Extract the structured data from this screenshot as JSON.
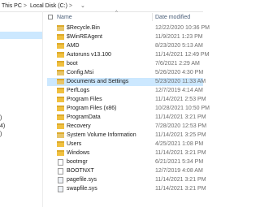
{
  "breadcrumb": {
    "items": [
      "This PC",
      "Local Disk (C:)"
    ],
    "separator": ">"
  },
  "nav_pane": {
    "visible_fragments": [
      ")",
      "4)",
      ")"
    ]
  },
  "columns": {
    "name": "Name",
    "date_modified": "Date modified"
  },
  "files": [
    {
      "name": "$Recycle.Bin",
      "date": "12/22/2020 10:36 PM",
      "type": "folder-system"
    },
    {
      "name": "$WinREAgent",
      "date": "11/9/2021 1:23 PM",
      "type": "folder"
    },
    {
      "name": "AMD",
      "date": "8/23/2020 5:13 AM",
      "type": "folder"
    },
    {
      "name": "Autoruns v13.100",
      "date": "11/14/2021 12:49 PM",
      "type": "folder"
    },
    {
      "name": "boot",
      "date": "7/6/2021 2:29 AM",
      "type": "folder"
    },
    {
      "name": "Config.Msi",
      "date": "5/26/2020 4:30 PM",
      "type": "folder-system"
    },
    {
      "name": "Documents and Settings",
      "date": "5/23/2020 11:33 AM",
      "type": "folder-link",
      "highlighted": true
    },
    {
      "name": "PerfLogs",
      "date": "12/7/2019 4:14 AM",
      "type": "folder"
    },
    {
      "name": "Program Files",
      "date": "11/14/2021 2:53 PM",
      "type": "folder"
    },
    {
      "name": "Program Files (x86)",
      "date": "10/28/2021 10:50 PM",
      "type": "folder"
    },
    {
      "name": "ProgramData",
      "date": "11/14/2021 3:21 PM",
      "type": "folder"
    },
    {
      "name": "Recovery",
      "date": "7/28/2020 12:53 PM",
      "type": "folder"
    },
    {
      "name": "System Volume Information",
      "date": "11/14/2021 3:25 PM",
      "type": "folder-system"
    },
    {
      "name": "Users",
      "date": "4/25/2021 1:08 PM",
      "type": "folder"
    },
    {
      "name": "Windows",
      "date": "11/14/2021 3:21 PM",
      "type": "folder"
    },
    {
      "name": "bootmgr",
      "date": "6/21/2021 5:34 PM",
      "type": "file"
    },
    {
      "name": "BOOTNXT",
      "date": "12/7/2019 4:08 AM",
      "type": "file"
    },
    {
      "name": "pagefile.sys",
      "date": "11/14/2021 3:21 PM",
      "type": "file-gear"
    },
    {
      "name": "swapfile.sys",
      "date": "11/14/2021 3:21 PM",
      "type": "file-gear"
    }
  ]
}
